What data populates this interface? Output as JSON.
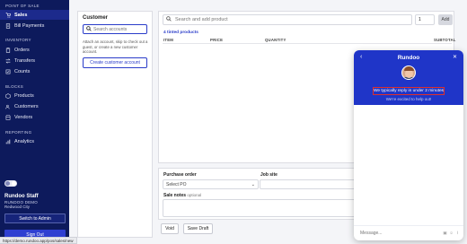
{
  "sidebar": {
    "sections": {
      "pos": "POINT OF SALE",
      "inventory": "INVENTORY",
      "blocks": "BLOCKS",
      "reporting": "REPORTING"
    },
    "items": {
      "sales": "Sales",
      "bill_payments": "Bill Payments",
      "orders": "Orders",
      "transfers": "Transfers",
      "counts": "Counts",
      "products": "Products",
      "customers": "Customers",
      "vendors": "Vendors",
      "analytics": "Analytics"
    },
    "staff_name": "Rundoo Staff",
    "company": "RUNDOO DEMO",
    "city": "Redwood City",
    "switch_label": "Switch to Admin",
    "signout_label": "Sign Out"
  },
  "status_url": "https://demo.rundoo.app/pos/sales/new",
  "customer": {
    "title": "Customer",
    "search_placeholder": "Search accounts",
    "help_text": "Attach an account, skip to check out a guest, or create a new customer account.",
    "create_label": "Create customer account"
  },
  "products": {
    "search_placeholder": "Search and add product",
    "qty_value": "1",
    "add_label": "Add",
    "items_count": "4 tinted products",
    "columns": {
      "item": "ITEM",
      "price": "PRICE",
      "quantity": "QUANTITY",
      "subtotal": "SUBTOTAL"
    }
  },
  "order": {
    "po_label": "Purchase order",
    "po_placeholder": "Select PO",
    "job_label": "Job site",
    "notes_label": "Sale notes",
    "notes_optional": "optional",
    "void_label": "Void",
    "draft_label": "Save Draft"
  },
  "chat": {
    "title": "Rundoo",
    "reply_time": "We typically reply in under 2 minutes",
    "excited": "We're excited to help out!",
    "input_placeholder": "Message..."
  },
  "colors": {
    "sidebar": "#0d1a5c",
    "accent": "#2a3cc9",
    "chat_header": "#1f35c8",
    "highlight": "#e0302a"
  }
}
